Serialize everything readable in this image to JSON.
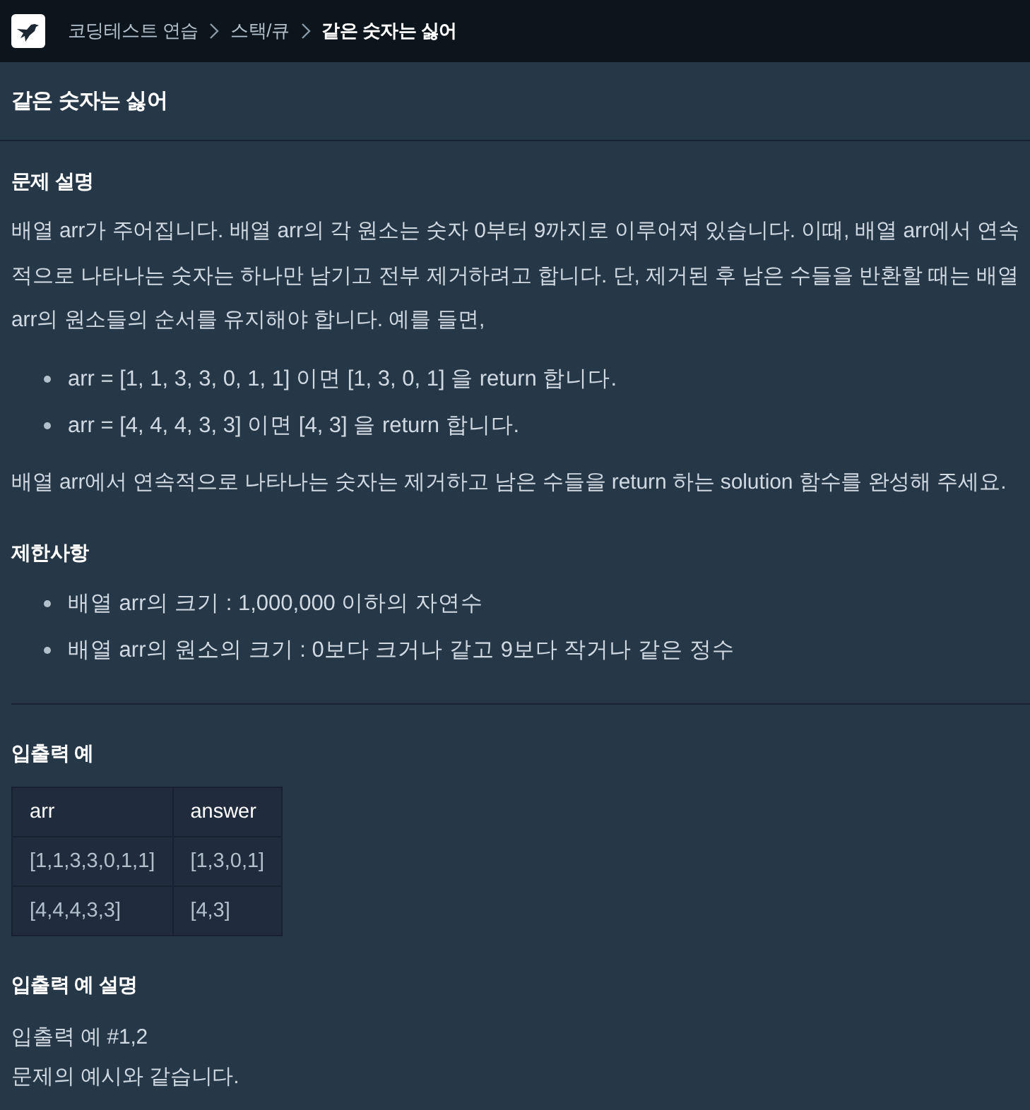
{
  "nav": {
    "breadcrumbs": [
      {
        "label": "코딩테스트 연습",
        "current": false
      },
      {
        "label": "스택/큐",
        "current": false
      },
      {
        "label": "같은 숫자는 싫어",
        "current": true
      }
    ]
  },
  "title": "같은 숫자는 싫어",
  "sections": [
    {
      "heading": "문제 설명",
      "blocks": [
        {
          "kind": "paragraph",
          "text": "배열 arr가 주어집니다. 배열 arr의 각 원소는 숫자 0부터 9까지로 이루어져 있습니다. 이때, 배열 arr에서 연속적으로 나타나는 숫자는 하나만 남기고 전부 제거하려고 합니다. 단, 제거된 후 남은 수들을 반환할 때는 배열 arr의 원소들의 순서를 유지해야 합니다. 예를 들면,"
        },
        {
          "kind": "list",
          "items": [
            "arr = [1, 1, 3, 3, 0, 1, 1] 이면 [1, 3, 0, 1] 을 return 합니다.",
            "arr = [4, 4, 4, 3, 3] 이면 [4, 3] 을 return 합니다."
          ]
        },
        {
          "kind": "paragraph",
          "text": "배열 arr에서 연속적으로 나타나는 숫자는 제거하고 남은 수들을 return 하는 solution 함수를 완성해 주세요."
        }
      ]
    },
    {
      "heading": "제한사항",
      "blocks": [
        {
          "kind": "list",
          "items": [
            "배열 arr의 크기 : 1,000,000 이하의 자연수",
            "배열 arr의 원소의 크기 : 0보다 크거나 같고 9보다 작거나 같은 정수"
          ]
        },
        {
          "kind": "divider"
        }
      ]
    },
    {
      "heading": "입출력 예",
      "blocks": [
        {
          "kind": "table",
          "columns": [
            "arr",
            "answer"
          ],
          "rows": [
            [
              "[1,1,3,3,0,1,1]",
              "[1,3,0,1]"
            ],
            [
              "[4,4,4,3,3]",
              "[4,3]"
            ]
          ]
        }
      ]
    },
    {
      "heading": "입출력 예 설명",
      "blocks": [
        {
          "kind": "lines",
          "lines": [
            "입출력 예 #1,2",
            "문제의 예시와 같습니다."
          ]
        }
      ]
    }
  ]
}
